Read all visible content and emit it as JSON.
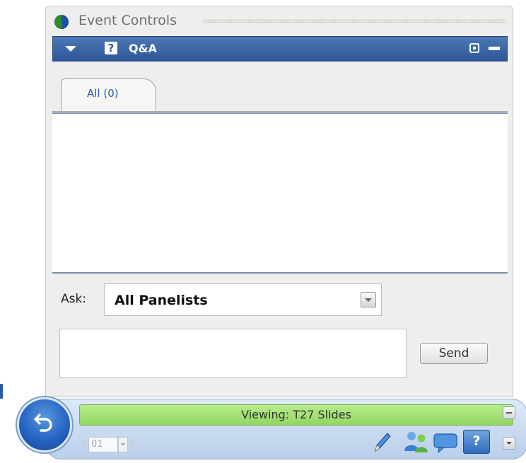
{
  "window": {
    "title": "Event Controls"
  },
  "panel": {
    "title": "Q&A",
    "icon_glyph": "?"
  },
  "tabs": [
    {
      "label": "All (0)",
      "selected": true
    }
  ],
  "ask": {
    "label": "Ask:",
    "selected": "All Panelists"
  },
  "message": {
    "value": "",
    "placeholder": ""
  },
  "send_button": {
    "label": "Send"
  },
  "status_bar": {
    "status_text": "Viewing: T27 Slides",
    "page_number": "01",
    "tools": [
      "pen-icon",
      "participants-icon",
      "chat-icon",
      "qa-icon"
    ],
    "active_tool_glyph": "?"
  },
  "colors": {
    "header_blue": "#2d5797",
    "status_green": "#a6e377",
    "tab_text": "#2a58a8"
  }
}
